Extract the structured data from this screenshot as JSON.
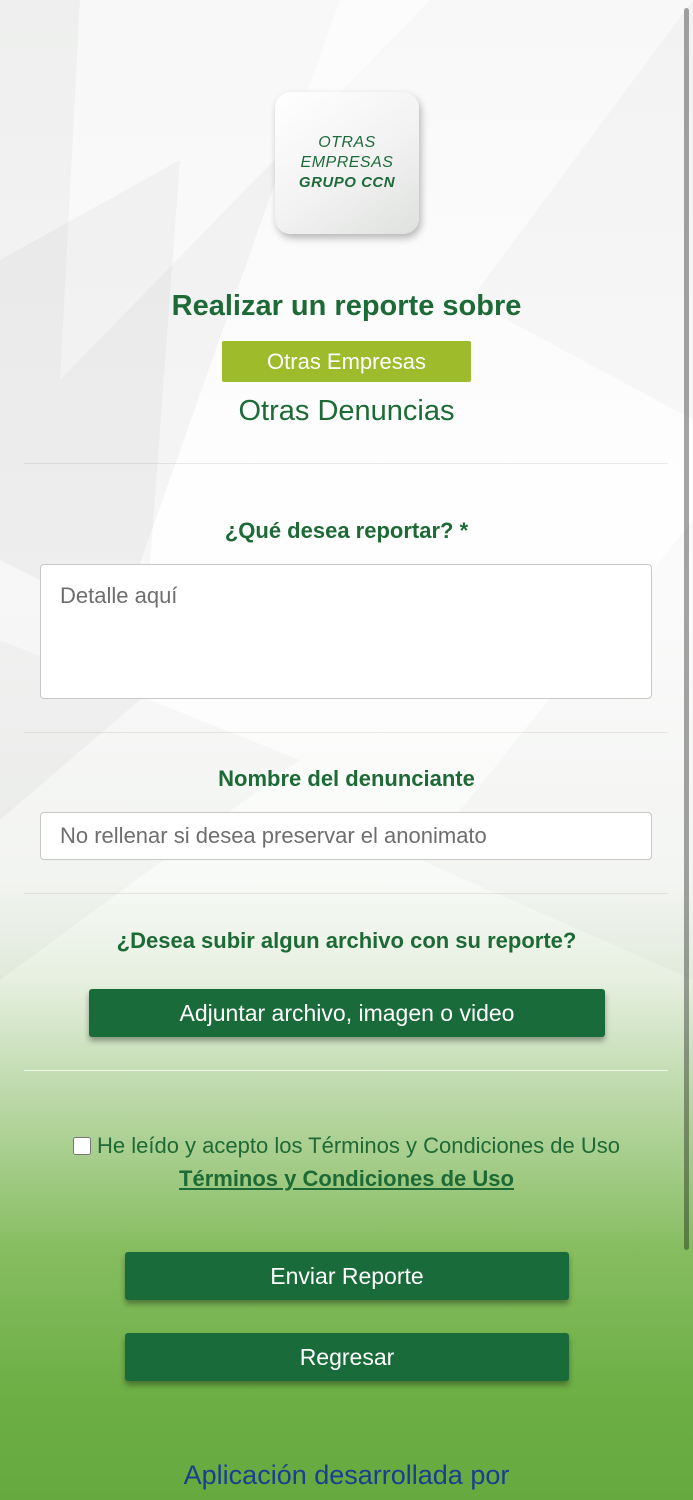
{
  "logo": {
    "line1": "OTRAS",
    "line2": "EMPRESAS",
    "line3": "GRUPO CCN"
  },
  "header": {
    "title": "Realizar un reporte sobre",
    "company": "Otras Empresas",
    "category": "Otras Denuncias"
  },
  "report_field": {
    "label": "¿Qué desea reportar? *",
    "placeholder": "Detalle aquí",
    "value": ""
  },
  "name_field": {
    "label": "Nombre del denunciante",
    "placeholder": "No rellenar si desea preservar el anonimato",
    "value": ""
  },
  "upload": {
    "question": "¿Desea subir algun archivo con su reporte?",
    "button_label": "Adjuntar archivo, imagen o video"
  },
  "terms": {
    "checked": false,
    "text": "He leído y acepto los Términos y Condiciones de Uso",
    "link_label": "Términos y Condiciones de Uso"
  },
  "actions": {
    "send_label": "Enviar Reporte",
    "back_label": "Regresar"
  },
  "footer": {
    "text": "Aplicación desarrollada por"
  },
  "colors": {
    "primary_green": "#196b3a",
    "text_green": "#1d6a36",
    "badge_green": "#9ebb2b",
    "footer_blue": "#1a3f8f"
  }
}
